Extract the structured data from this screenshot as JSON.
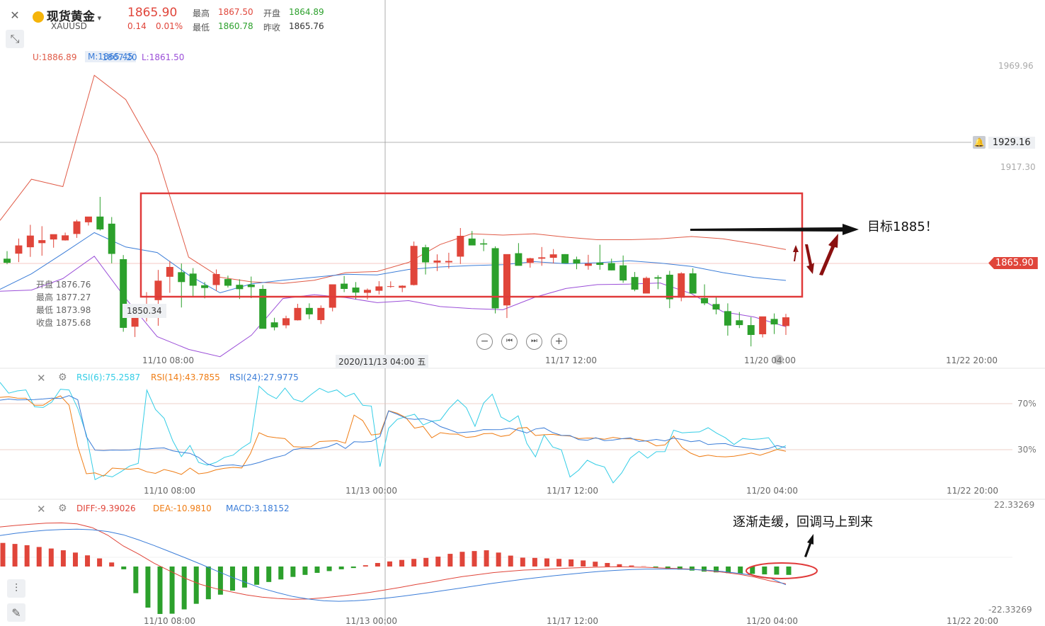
{
  "header": {
    "name": "现货黄金",
    "symbol": "XAUUSD",
    "price": "1865.90",
    "change": "0.14",
    "change_pct": "0.01%",
    "high_label": "最高",
    "high": "1867.50",
    "open_label": "开盘",
    "open": "1864.89",
    "low_label": "最低",
    "low": "1860.78",
    "prev_label": "昨收",
    "prev": "1865.76"
  },
  "boll_legend": {
    "upper": "U:1886.89",
    "middle": "M:1865.45",
    "middle_overlap": "1867.20",
    "lower": "L:1861.50"
  },
  "ohlc_tooltip": {
    "open": "开盘 1876.76",
    "high": "最高 1877.27",
    "low": "最低 1873.98",
    "close": "收盘 1875.68"
  },
  "low_marker": "1850.34",
  "price_axis": {
    "top": "1969.96",
    "alert": "1929.16",
    "mid": "1917.30",
    "current": "1865.90"
  },
  "time_axis": {
    "t1": "11/10 08:00",
    "cursor": "2020/11/13 04:00 五",
    "t3": "11/17 12:00",
    "t4": "11/20 04:00",
    "t5": "11/22 20:00"
  },
  "sub_time_axis": [
    "11/10 08:00",
    "11/13 00:00",
    "11/17 12:00",
    "11/20 04:00",
    "11/22 20:00"
  ],
  "nav_buttons": [
    "zoom-out",
    "jump-start",
    "jump-end",
    "zoom-in"
  ],
  "rsi": {
    "legend": [
      "RSI(6):75.2587",
      "RSI(14):43.7855",
      "RSI(24):27.9775"
    ],
    "lvl_hi": "70%",
    "lvl_lo": "30%"
  },
  "macd": {
    "legend": [
      "DIFF:-9.39026",
      "DEA:-10.9810",
      "MACD:3.18152"
    ],
    "max": "22.33269",
    "min": "-22.33269"
  },
  "annotations": {
    "target": "目标1885！",
    "note": "逐渐走缓，回调马上到来"
  },
  "colors": {
    "up": "#e0453a",
    "down": "#2ca02c",
    "upper_band": "#e05a46",
    "mid_band": "#3b7dd8",
    "lower_band": "#9b4fd8",
    "rsi6": "#33cde6",
    "rsi14": "#ef7d15",
    "rsi24": "#3b7dd8",
    "box": "#e03a3a",
    "arrow": "#8b1010"
  },
  "chart_data": [
    {
      "type": "candlestick",
      "title": "现货黄金 XAUUSD",
      "x_ticks": [
        "11/10 08:00",
        "11/13 04:00",
        "11/17 12:00",
        "11/20 04:00",
        "11/22 20:00"
      ],
      "ylim": [
        1835,
        1985
      ],
      "bars": [
        [
          1878.2,
          1881.5,
          1875.8,
          1876.4
        ],
        [
          1880.4,
          1887.0,
          1876.7,
          1884.0
        ],
        [
          1883.2,
          1893.0,
          1879.0,
          1888.3
        ],
        [
          1885.0,
          1892.4,
          1879.5,
          1886.3
        ],
        [
          1886.6,
          1888.5,
          1883.0,
          1888.9
        ],
        [
          1886.2,
          1889.6,
          1886.1,
          1888.4
        ],
        [
          1889.0,
          1895.2,
          1887.3,
          1894.5
        ],
        [
          1894.1,
          1896.5,
          1892.7,
          1896.6
        ],
        [
          1896.6,
          1905.2,
          1890.5,
          1891.0
        ],
        [
          1893.5,
          1896.4,
          1876.2,
          1880.3
        ],
        [
          1878.0,
          1879.8,
          1846.3,
          1848.0
        ],
        [
          1848.5,
          1856.2,
          1844.0,
          1855.3
        ],
        [
          1852.8,
          1863.6,
          1850.8,
          1858.5
        ],
        [
          1860.1,
          1873.3,
          1848.9,
          1868.6
        ],
        [
          1870.3,
          1877.2,
          1863.3,
          1874.6
        ],
        [
          1872.3,
          1876.1,
          1856.9,
          1868.0
        ],
        [
          1871.7,
          1874.1,
          1861.5,
          1866.4
        ],
        [
          1866.6,
          1868.0,
          1860.9,
          1865.4
        ],
        [
          1866.7,
          1873.5,
          1864.1,
          1871.5
        ],
        [
          1869.3,
          1870.8,
          1865.6,
          1866.4
        ],
        [
          1866.8,
          1869.2,
          1860.6,
          1864.9
        ],
        [
          1866.9,
          1870.4,
          1861.0,
          1865.8
        ],
        [
          1865.0,
          1866.7,
          1851.5,
          1847.6
        ],
        [
          1850.4,
          1852.4,
          1846.9,
          1848.2
        ],
        [
          1849.1,
          1853.3,
          1847.8,
          1852.2
        ],
        [
          1851.3,
          1858.5,
          1851.2,
          1856.7
        ],
        [
          1856.7,
          1858.7,
          1851.8,
          1853.9
        ],
        [
          1851.4,
          1857.8,
          1849.7,
          1856.7
        ],
        [
          1856.8,
          1866.5,
          1855.2,
          1867.0
        ],
        [
          1867.3,
          1870.7,
          1863.6,
          1865.0
        ],
        [
          1865.6,
          1868.0,
          1860.5,
          1863.4
        ],
        [
          1863.3,
          1865.2,
          1860.4,
          1864.6
        ],
        [
          1864.2,
          1868.4,
          1862.6,
          1866.1
        ],
        [
          1866.2,
          1868.3,
          1865.5,
          1866.2
        ],
        [
          1865.5,
          1866.6,
          1863.6,
          1866.4
        ],
        [
          1866.7,
          1885.7,
          1866.5,
          1883.8
        ],
        [
          1883.2,
          1884.3,
          1871.3,
          1876.6
        ],
        [
          1876.5,
          1880.1,
          1872.8,
          1877.4
        ],
        [
          1876.6,
          1880.8,
          1873.9,
          1877.2
        ],
        [
          1879.1,
          1891.6,
          1875.9,
          1888.2
        ],
        [
          1887.0,
          1890.3,
          1884.4,
          1884.0
        ],
        [
          1884.9,
          1886.8,
          1881.5,
          1884.4
        ],
        [
          1882.8,
          1883.6,
          1854.3,
          1856.5
        ],
        [
          1857.8,
          1861.1,
          1852.3,
          1880.2
        ],
        [
          1880.6,
          1885.0,
          1875.8,
          1875.1
        ],
        [
          1876.4,
          1878.6,
          1874.3,
          1878.4
        ],
        [
          1878.2,
          1883.3,
          1875.1,
          1878.8
        ],
        [
          1878.6,
          1882.4,
          1876.2,
          1880.1
        ],
        [
          1880.2,
          1880.2,
          1876.7,
          1876.2
        ],
        [
          1877.9,
          1879.1,
          1873.6,
          1876.1
        ],
        [
          1875.1,
          1879.9,
          1873.4,
          1876.1
        ],
        [
          1876.5,
          1884.3,
          1873.4,
          1875.5
        ],
        [
          1876.3,
          1878.2,
          1873.1,
          1873.1
        ],
        [
          1875.3,
          1879.6,
          1867.7,
          1868.7
        ],
        [
          1870.2,
          1872.4,
          1864.0,
          1864.7
        ],
        [
          1863.0,
          1870.4,
          1864.7,
          1869.8
        ],
        [
          1870.1,
          1871.0,
          1864.9,
          1869.5
        ],
        [
          1871.2,
          1872.9,
          1856.6,
          1860.5
        ],
        [
          1861.2,
          1872.3,
          1859.6,
          1871.8
        ],
        [
          1871.8,
          1874.0,
          1863.0,
          1863.0
        ],
        [
          1861.0,
          1867.0,
          1857.9,
          1858.7
        ],
        [
          1858.4,
          1861.5,
          1853.9,
          1856.0
        ],
        [
          1855.3,
          1858.7,
          1844.6,
          1849.0
        ],
        [
          1851.3,
          1854.9,
          1847.9,
          1849.2
        ],
        [
          1849.2,
          1852.7,
          1839.9,
          1844.9
        ],
        [
          1845.2,
          1852.3,
          1843.8,
          1853.0
        ],
        [
          1851.9,
          1854.3,
          1845.3,
          1849.5
        ],
        [
          1848.8,
          1854.1,
          1844.9,
          1852.6
        ]
      ],
      "bollinger": {
        "upper": [
          1894.9,
          1912.9,
          1909.7,
          1958.3,
          1947.7,
          1923.4,
          1878.9,
          1870.1,
          1868.1,
          1867.4,
          1868.8,
          1872.1,
          1872.6,
          1876.6,
          1884.4,
          1889.1,
          1888.5,
          1889.1,
          1887.6,
          1886.5,
          1886.5,
          1886.9,
          1887.9,
          1886.9,
          1884.7,
          1882.2
        ],
        "middle": [
          1864.8,
          1871.6,
          1880.5,
          1889.6,
          1883.3,
          1880.9,
          1871.1,
          1863.3,
          1867.2,
          1868.8,
          1870.1,
          1871.4,
          1871.1,
          1873.5,
          1874.6,
          1875.2,
          1875.6,
          1876.9,
          1876.0,
          1876.4,
          1877.3,
          1876.3,
          1874.8,
          1872.1,
          1870.0,
          1868.7
        ],
        "lower": [
          1864.0,
          1864.5,
          1869.5,
          1879.3,
          1860.8,
          1844.2,
          1838.6,
          1835.4,
          1844.8,
          1860.8,
          1862.5,
          1861.2,
          1859.0,
          1859.9,
          1857.3,
          1856.4,
          1855.9,
          1861.3,
          1865.2,
          1866.9,
          1867.1,
          1867.6,
          1862.9,
          1855.0,
          1852.7,
          1848.5
        ]
      }
    },
    {
      "type": "line",
      "title": "RSI",
      "ylim": [
        0,
        100
      ],
      "series": [
        {
          "name": "RSI(6)",
          "values": [
            100.8,
            90.5,
            92.5,
            93.4,
            78.5,
            77.9,
            82.6,
            94.0,
            93.3,
            77.2,
            53.8,
            14.2,
            18.1,
            16.6,
            21.1,
            26.1,
            28.5,
            93.2,
            76.1,
            68.3,
            48.5,
            34.5,
            44.3,
            29.4,
            27.0,
            29.4,
            33.9,
            35.8,
            42.1,
            47.0,
            96.7,
            89.7,
            85.7,
            95.0,
            85.2,
            82.9,
            89.1,
            94.8,
            91.2,
            93.4,
            87.4,
            90.4,
            79.8,
            79.1,
            25.6,
            59.5,
            67.4,
            69.8,
            71.9,
            62.4,
            65.7,
            66.8,
            77.0,
            84.6,
            77.6,
            61.2,
            81.8,
            89.6,
            69.5,
            65.3,
            70.5,
            46.1,
            34.3,
            53.6,
            43.0,
            40.5,
            16.5,
            22.5,
            31.3,
            27.5,
            25.4,
            11.3,
            20.2,
            33.3,
            39.1,
            33.2,
            38.8,
            38.9,
            57.8,
            55.5,
            56.0,
            56.3,
            60.0,
            55.1,
            51.1,
            45.2,
            50.5,
            49.6,
            50.1,
            51.2,
            40.9,
            44.1
          ],
          "vals_note": ""
        },
        {
          "name": "RSI(14)",
          "values": [
            86.8,
            87.3,
            86.1,
            86.0,
            79.8,
            79.8,
            84.8,
            88.1,
            79.9,
            43.5,
            19.4,
            20.1,
            17.3,
            24.4,
            23.8,
            23.4,
            24.1,
            21.1,
            19.7,
            23.1,
            21.3,
            18.8,
            24.4,
            19.3,
            20.3,
            22.8,
            24.2,
            25.0,
            24.5,
            37.2,
            55.6,
            52.2,
            51.2,
            50.4,
            43.3,
            42.9,
            43.2,
            47.8,
            48.2,
            48.5,
            46.4,
            71.2,
            66.3,
            53.6,
            54.5,
            75.0,
            72.8,
            68.9,
            59.6,
            61.1,
            51.1,
            55.6,
            54.5,
            54.3,
            51.4,
            52.2,
            54.7,
            55.0,
            52.3,
            53.5,
            59.6,
            60.2,
            53.1,
            53.8,
            54.1,
            53.1,
            52.6,
            50.4,
            50.9,
            50.8,
            49.9,
            51.5,
            50.3,
            50.1,
            49.6,
            47.9,
            44.0,
            44.8,
            52.6,
            42.5,
            37.5,
            34.5,
            35.8,
            34.6,
            34.3,
            34.9,
            36.1,
            37.6,
            35.7,
            38.2,
            40.9,
            39.2
          ]
        },
        {
          "name": "RSI(24)",
          "values": [
            84.3,
            85.3,
            84.5,
            84.7,
            84.8,
            85.4,
            86.1,
            85.8,
            88.3,
            84.7,
            52.2,
            40.2,
            39.8,
            40.3,
            40.1,
            40.3,
            41.3,
            41.1,
            41.9,
            42.2,
            39.6,
            38.3,
            37.4,
            33.8,
            28.1,
            25.7,
            26.8,
            27.2,
            26.1,
            27.4,
            29.3,
            31.9,
            34.0,
            35.8,
            40.7,
            41.9,
            41.4,
            41.6,
            43.2,
            46.2,
            41.7,
            47.6,
            47.4,
            47.9,
            52.2,
            74.8,
            71.9,
            68.3,
            67.4,
            68.0,
            65.8,
            61.0,
            58.4,
            55.5,
            56.1,
            56.7,
            58.4,
            58.3,
            58.4,
            59.6,
            57.8,
            55.4,
            58.9,
            59.9,
            55.7,
            53.3,
            53.1,
            49.5,
            48.9,
            51.2,
            48.6,
            49.1,
            50.3,
            51.0,
            47.9,
            48.5,
            49.7,
            48.4,
            50.9,
            49.6,
            47.7,
            48.6,
            45.1,
            45.8,
            46.0,
            43.7,
            42.9,
            41.8,
            40.6,
            41.7,
            44.3,
            42.3
          ]
        }
      ]
    },
    {
      "type": "bar",
      "title": "MACD",
      "ylim": [
        -22.33269,
        22.33269
      ],
      "values": [
        9.3,
        8.9,
        8.4,
        7.7,
        7.1,
        6.4,
        5.5,
        4.4,
        3.2,
        1.6,
        -1.1,
        -10.5,
        -16.2,
        -18.7,
        -18.6,
        -16.9,
        -14.7,
        -12.9,
        -11.1,
        -9.5,
        -8.3,
        -7.2,
        -6.1,
        -5.1,
        -4.1,
        -3.3,
        -2.5,
        -1.8,
        -1.1,
        -0.6,
        0.5,
        1.4,
        2.0,
        2.6,
        3.0,
        3.4,
        3.9,
        5.0,
        5.8,
        6.1,
        6.4,
        5.5,
        4.3,
        3.5,
        3.4,
        3.2,
        3.0,
        2.8,
        2.4,
        1.9,
        1.4,
        0.9,
        0.4,
        0.1,
        -0.4,
        -0.9,
        -1.2,
        -1.6,
        -2.0,
        -2.3,
        -2.6,
        -2.8,
        -2.9,
        -3.1,
        -3.2,
        -3.3
      ],
      "series": [
        {
          "name": "DIFF",
          "values": [
            15.6,
            16.2,
            16.7,
            17.1,
            17.2,
            16.8,
            15.3,
            12.3,
            8.1,
            4.9,
            1.3,
            -1.7,
            -4.6,
            -7.0,
            -8.7,
            -10.0,
            -11.2,
            -12.1,
            -12.6,
            -12.9,
            -12.8,
            -12.3,
            -11.7,
            -11.0,
            -10.2,
            -9.2,
            -8.2,
            -7.1,
            -6.1,
            -5.0,
            -4.0,
            -3.2,
            -2.4,
            -1.9,
            -1.4,
            -1.2,
            -0.9,
            -0.6,
            -0.4,
            -0.2,
            -0.1,
            -0.2,
            -0.3,
            -0.6,
            -0.8,
            -1.1,
            -1.7,
            -2.3,
            -3.1,
            -4.2,
            -5.7,
            -6.8
          ]
        },
        {
          "name": "DEA",
          "values": [
            12.2,
            13.1,
            13.8,
            14.3,
            14.6,
            14.7,
            14.5,
            13.8,
            12.5,
            10.5,
            8.3,
            5.9,
            3.5,
            1.0,
            -1.6,
            -4.1,
            -6.4,
            -8.6,
            -10.3,
            -11.8,
            -12.8,
            -13.5,
            -13.7,
            -13.5,
            -13.1,
            -12.5,
            -11.8,
            -11.0,
            -10.2,
            -9.3,
            -8.4,
            -7.5,
            -6.6,
            -5.8,
            -5.0,
            -4.3,
            -3.6,
            -3.0,
            -2.4,
            -1.9,
            -1.5,
            -1.2,
            -1.0,
            -1.0,
            -1.0,
            -1.2,
            -1.5,
            -2.0,
            -2.7,
            -3.6,
            -4.6,
            -7.2
          ]
        }
      ]
    }
  ]
}
